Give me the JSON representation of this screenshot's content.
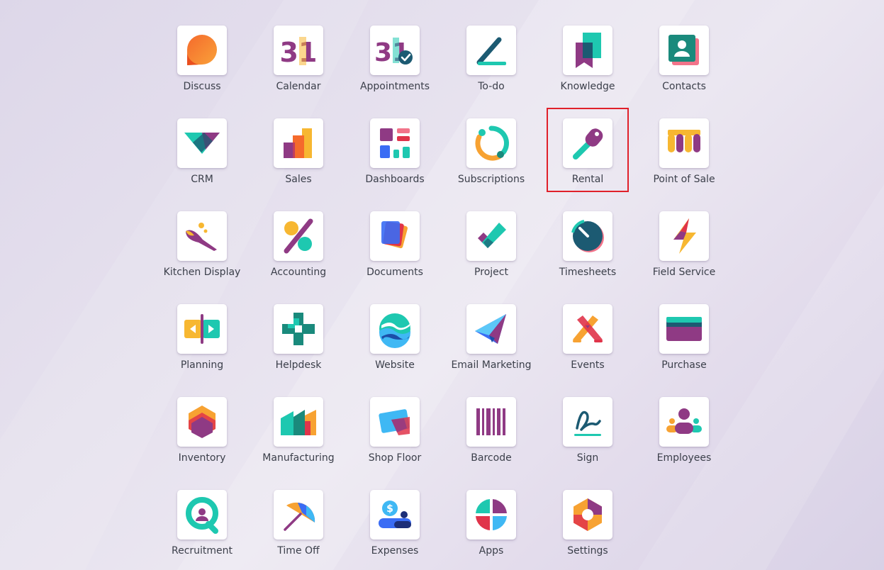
{
  "apps": [
    {
      "key": "discuss",
      "label": "Discuss",
      "icon": "discuss-icon"
    },
    {
      "key": "calendar",
      "label": "Calendar",
      "icon": "calendar-icon",
      "icon_text": "31"
    },
    {
      "key": "appointments",
      "label": "Appointments",
      "icon": "appointments-icon",
      "icon_text": "31"
    },
    {
      "key": "to-do",
      "label": "To-do",
      "icon": "to-do-icon"
    },
    {
      "key": "knowledge",
      "label": "Knowledge",
      "icon": "knowledge-icon"
    },
    {
      "key": "contacts",
      "label": "Contacts",
      "icon": "contacts-icon"
    },
    {
      "key": "crm",
      "label": "CRM",
      "icon": "crm-icon"
    },
    {
      "key": "sales",
      "label": "Sales",
      "icon": "sales-icon"
    },
    {
      "key": "dashboards",
      "label": "Dashboards",
      "icon": "dashboards-icon"
    },
    {
      "key": "subscriptions",
      "label": "Subscriptions",
      "icon": "subscriptions-icon"
    },
    {
      "key": "rental",
      "label": "Rental",
      "icon": "rental-icon"
    },
    {
      "key": "point-of-sale",
      "label": "Point of Sale",
      "icon": "point-of-sale-icon"
    },
    {
      "key": "kitchen-display",
      "label": "Kitchen Display",
      "icon": "kitchen-display-icon"
    },
    {
      "key": "accounting",
      "label": "Accounting",
      "icon": "accounting-icon"
    },
    {
      "key": "documents",
      "label": "Documents",
      "icon": "documents-icon"
    },
    {
      "key": "project",
      "label": "Project",
      "icon": "project-icon"
    },
    {
      "key": "timesheets",
      "label": "Timesheets",
      "icon": "timesheets-icon"
    },
    {
      "key": "field-service",
      "label": "Field Service",
      "icon": "field-service-icon"
    },
    {
      "key": "planning",
      "label": "Planning",
      "icon": "planning-icon"
    },
    {
      "key": "helpdesk",
      "label": "Helpdesk",
      "icon": "helpdesk-icon"
    },
    {
      "key": "website",
      "label": "Website",
      "icon": "website-icon"
    },
    {
      "key": "email-marketing",
      "label": "Email Marketing",
      "icon": "email-marketing-icon"
    },
    {
      "key": "events",
      "label": "Events",
      "icon": "events-icon"
    },
    {
      "key": "purchase",
      "label": "Purchase",
      "icon": "purchase-icon"
    },
    {
      "key": "inventory",
      "label": "Inventory",
      "icon": "inventory-icon"
    },
    {
      "key": "manufacturing",
      "label": "Manufacturing",
      "icon": "manufacturing-icon"
    },
    {
      "key": "shop-floor",
      "label": "Shop Floor",
      "icon": "shop-floor-icon"
    },
    {
      "key": "barcode",
      "label": "Barcode",
      "icon": "barcode-icon"
    },
    {
      "key": "sign",
      "label": "Sign",
      "icon": "sign-icon"
    },
    {
      "key": "employees",
      "label": "Employees",
      "icon": "employees-icon"
    },
    {
      "key": "recruitment",
      "label": "Recruitment",
      "icon": "recruitment-icon"
    },
    {
      "key": "time-off",
      "label": "Time Off",
      "icon": "time-off-icon"
    },
    {
      "key": "expenses",
      "label": "Expenses",
      "icon": "expenses-icon",
      "icon_text": "$"
    },
    {
      "key": "apps",
      "label": "Apps",
      "icon": "apps-icon"
    },
    {
      "key": "settings",
      "label": "Settings",
      "icon": "settings-icon"
    }
  ],
  "highlighted_app": "rental",
  "colors": {
    "highlight": "#e0202a",
    "label": "#3b3f4a",
    "tile_bg": "#ffffff"
  }
}
